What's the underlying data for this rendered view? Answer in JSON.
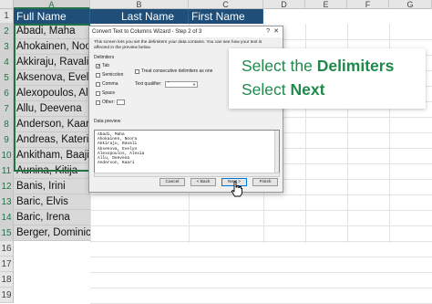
{
  "sheet": {
    "columns": [
      "A",
      "B",
      "C",
      "D",
      "E",
      "F",
      "G"
    ],
    "selected_column": "A",
    "header_row": {
      "a": "Full Name",
      "b": "Last Name",
      "c": "First Name"
    },
    "row_numbers": [
      "1",
      "2",
      "3",
      "4",
      "5",
      "6",
      "7",
      "8",
      "9",
      "10",
      "11",
      "12",
      "13",
      "14",
      "15",
      "16",
      "17",
      "18",
      "19"
    ],
    "names": [
      "Abadi, Maha",
      "Ahokainen, Noora",
      "Akkiraju, Ravali",
      "Aksenova, Evelyn",
      "Alexopoulos, Alexia",
      "Allu, Deevena",
      "Anderson, Kaari",
      "Andreas, Katerina",
      "Ankitham, Baaji",
      "Aunina, Kitija",
      "Banis, Irini",
      "Baric, Elvis",
      "Baric, Irena",
      "Berger, Dominic"
    ]
  },
  "dialog": {
    "title": "Convert Text to Columns Wizard - Step 2 of 3",
    "help": "?",
    "close": "✕",
    "description": "This screen lets you set the delimiters your data contains. You can see how your text is affected in the preview below.",
    "delimiters_label": "Delimiters",
    "options": [
      {
        "label": "Tab",
        "checked": true
      },
      {
        "label": "Semicolon",
        "checked": false
      },
      {
        "label": "Comma",
        "checked": false
      },
      {
        "label": "Space",
        "checked": false
      },
      {
        "label": "Other:",
        "checked": false
      }
    ],
    "consecutive_label": "Treat consecutive delimiters as one",
    "qualifier_label": "Text qualifier:",
    "qualifier_value": "\"",
    "preview_label": "Data preview",
    "preview_lines": [
      "Abadi, Maha",
      "Ahokainen, Noora",
      "Akkiraju, Ravali",
      "Aksenova, Evelyn",
      "Alexopoulos, Alexia",
      "Allu, Deevena",
      "Anderson, Kaari"
    ],
    "buttons": {
      "cancel": "Cancel",
      "back": "< Back",
      "next": "Next >",
      "finish": "Finish"
    }
  },
  "callout": {
    "line1_prefix": "Select the ",
    "line1_bold": "Delimiters",
    "line2_prefix": "Select ",
    "line2_bold": "Next"
  },
  "colors": {
    "accent": "#217346",
    "header_fill": "#1f4e79",
    "callout_text": "#1e8a4a"
  }
}
